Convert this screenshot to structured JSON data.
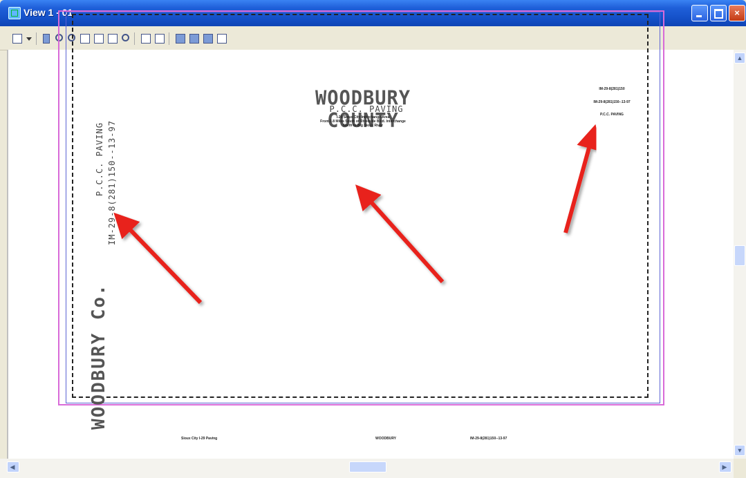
{
  "window": {
    "title": "View 1 - 01",
    "buttons": {
      "minimize_icon": "minimize-icon",
      "maximize_icon": "restore-icon",
      "close_icon": "close-icon",
      "close_glyph": "×"
    }
  },
  "toolbar": {
    "icons": [
      "view-control-icon",
      "dropdown-arrow-icon",
      "pan-icon",
      "zoom-in-icon",
      "zoom-out-icon",
      "window-area-icon",
      "fit-view-icon",
      "rotate-view-icon",
      "view-previous-icon",
      "view-next-icon",
      "copy-view-icon",
      "clip-volume-icon",
      "clip-mask-icon",
      "camera-icon",
      "render-icon"
    ]
  },
  "drawing": {
    "title": "WOODBURY COUNTY",
    "subtitle": "P.C.C. PAVING",
    "description_lines": [
      "I-29 Sioux City Interchange Area",
      "From 3.8 Miles South of Riverside Blvd. Interchange",
      "North to Big Sioux River"
    ],
    "left_vertical_1": "P.C.C. PAVING",
    "left_vertical_2": "IM-29-8(281)150--13-97",
    "county_vertical": "WOODBURY Co.",
    "top_right_lines": [
      "IM-29-8(281)150",
      "IM-29-8(281)150--13-97",
      "P.C.C. PAVING"
    ],
    "bottom_left": "Sioux City I-29 Paving",
    "bottom_center": "WOODBURY",
    "bottom_right": "IM-29-8(281)150--13-97"
  },
  "scrollbars": {
    "up_glyph": "▲",
    "down_glyph": "▼",
    "left_glyph": "◀",
    "right_glyph": "▶"
  },
  "colors": {
    "annotation_arrow": "#e8231c",
    "sheet_border": "#d86ad8",
    "sheet_inner": "#5b63d4",
    "titlebar": "#1f5fd9"
  }
}
